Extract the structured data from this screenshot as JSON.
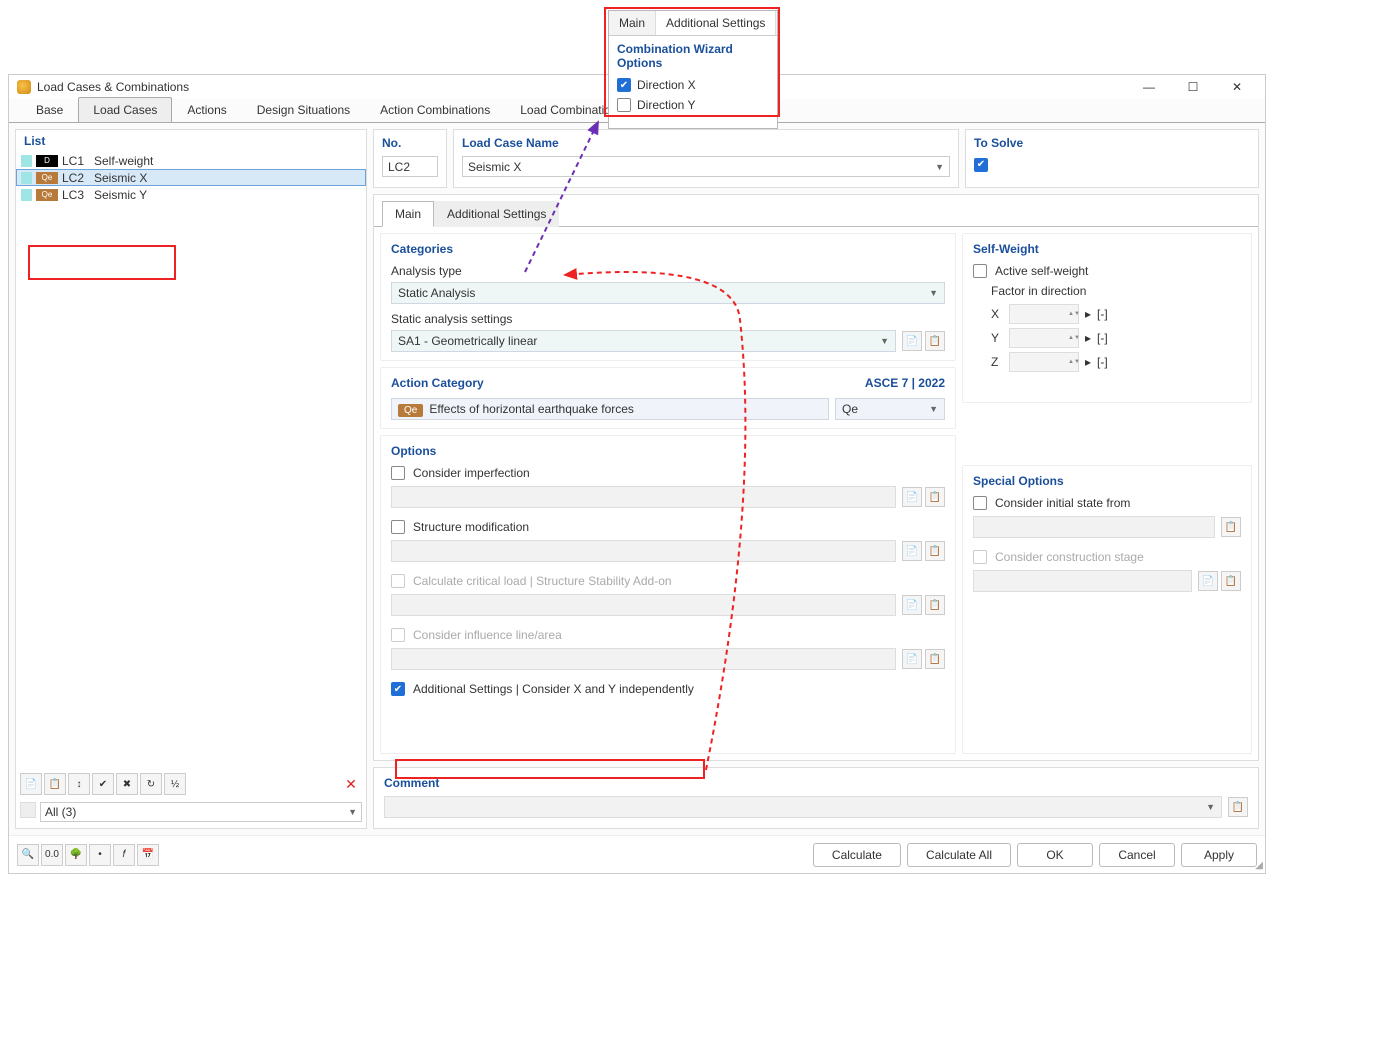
{
  "window": {
    "title": "Load Cases & Combinations"
  },
  "tabs": [
    "Base",
    "Load Cases",
    "Actions",
    "Design Situations",
    "Action Combinations",
    "Load Combinations"
  ],
  "active_tab": "Load Cases",
  "list": {
    "header": "List",
    "items": [
      {
        "tag": "D",
        "tag_bg": "black",
        "code": "LC1",
        "name": "Self-weight"
      },
      {
        "tag": "Qe",
        "tag_bg": "brown",
        "code": "LC2",
        "name": "Seismic X"
      },
      {
        "tag": "Qe",
        "tag_bg": "brown",
        "code": "LC3",
        "name": "Seismic Y"
      }
    ],
    "filter": "All (3)"
  },
  "fields": {
    "no_label": "No.",
    "no_value": "LC2",
    "name_label": "Load Case Name",
    "name_value": "Seismic X",
    "solve_label": "To Solve"
  },
  "detail_tabs": {
    "main": "Main",
    "additional": "Additional Settings"
  },
  "categories": {
    "title": "Categories",
    "analysis_label": "Analysis type",
    "analysis_value": "Static Analysis",
    "static_label": "Static analysis settings",
    "static_value": "SA1 - Geometrically linear"
  },
  "action_category": {
    "title": "Action Category",
    "code_ref": "ASCE 7 | 2022",
    "badge": "Qe",
    "name": "Effects of horizontal earthquake forces",
    "short": "Qe"
  },
  "options": {
    "title": "Options",
    "imperfection": "Consider imperfection",
    "structure": "Structure modification",
    "critical": "Calculate critical load | Structure Stability Add-on",
    "influence": "Consider influence line/area",
    "additional": "Additional Settings | Consider X and Y independently"
  },
  "self_weight": {
    "title": "Self-Weight",
    "active": "Active self-weight",
    "factor_label": "Factor in direction",
    "axes": [
      "X",
      "Y",
      "Z"
    ],
    "unit": "[-]"
  },
  "special": {
    "title": "Special Options",
    "initial": "Consider initial state from",
    "stage": "Consider construction stage"
  },
  "comment": {
    "title": "Comment"
  },
  "footer": {
    "calc": "Calculate",
    "calc_all": "Calculate All",
    "ok": "OK",
    "cancel": "Cancel",
    "apply": "Apply"
  },
  "popup": {
    "tab_main": "Main",
    "tab_add": "Additional Settings",
    "title": "Combination Wizard Options",
    "dir_x": "Direction X",
    "dir_y": "Direction Y"
  }
}
